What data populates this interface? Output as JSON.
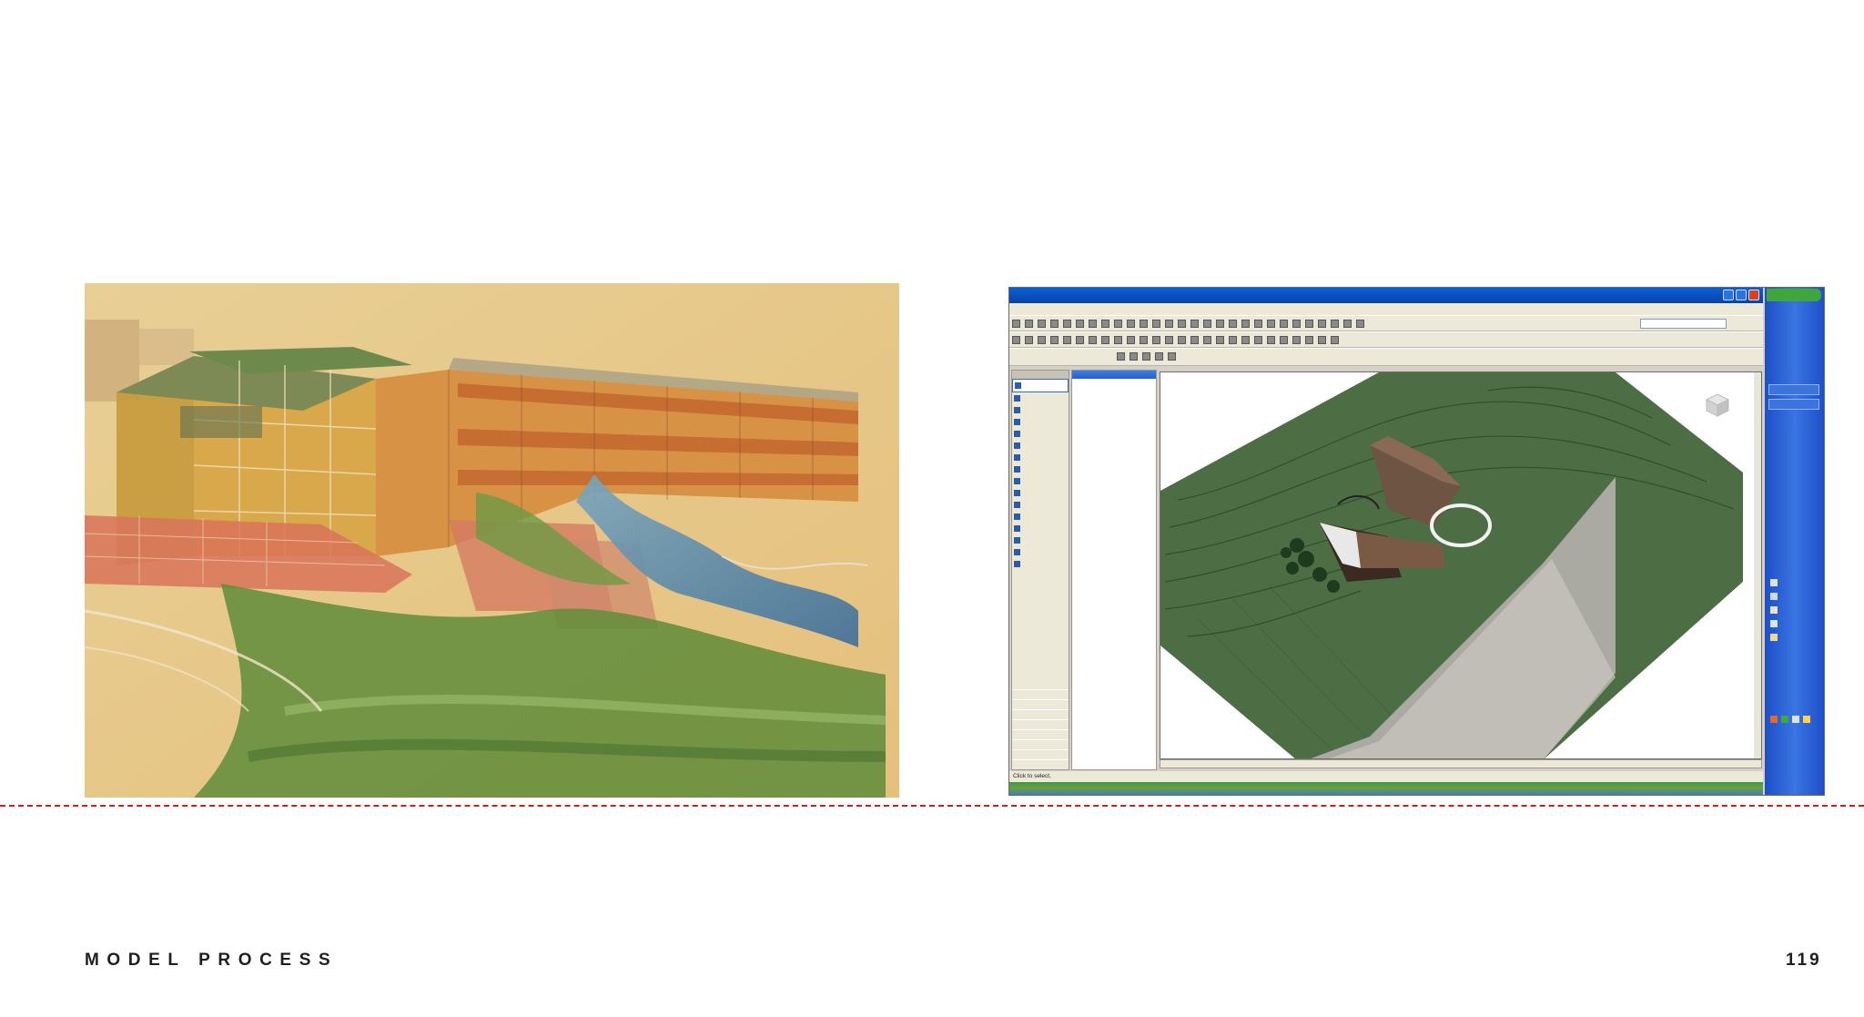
{
  "footer": {
    "section_title": "MODEL PROCESS",
    "page_number": "119"
  },
  "colors": {
    "rule": "#c62020",
    "paper": "#e9c98a",
    "terrain": "#4d6e45",
    "xp_blue": "#2459d6"
  },
  "revit": {
    "status_prefix": "Click to select,"
  },
  "icons": {
    "window_controls": [
      "minimize-icon",
      "maximize-icon",
      "close-icon"
    ],
    "viewcube": "viewcube-icon"
  }
}
